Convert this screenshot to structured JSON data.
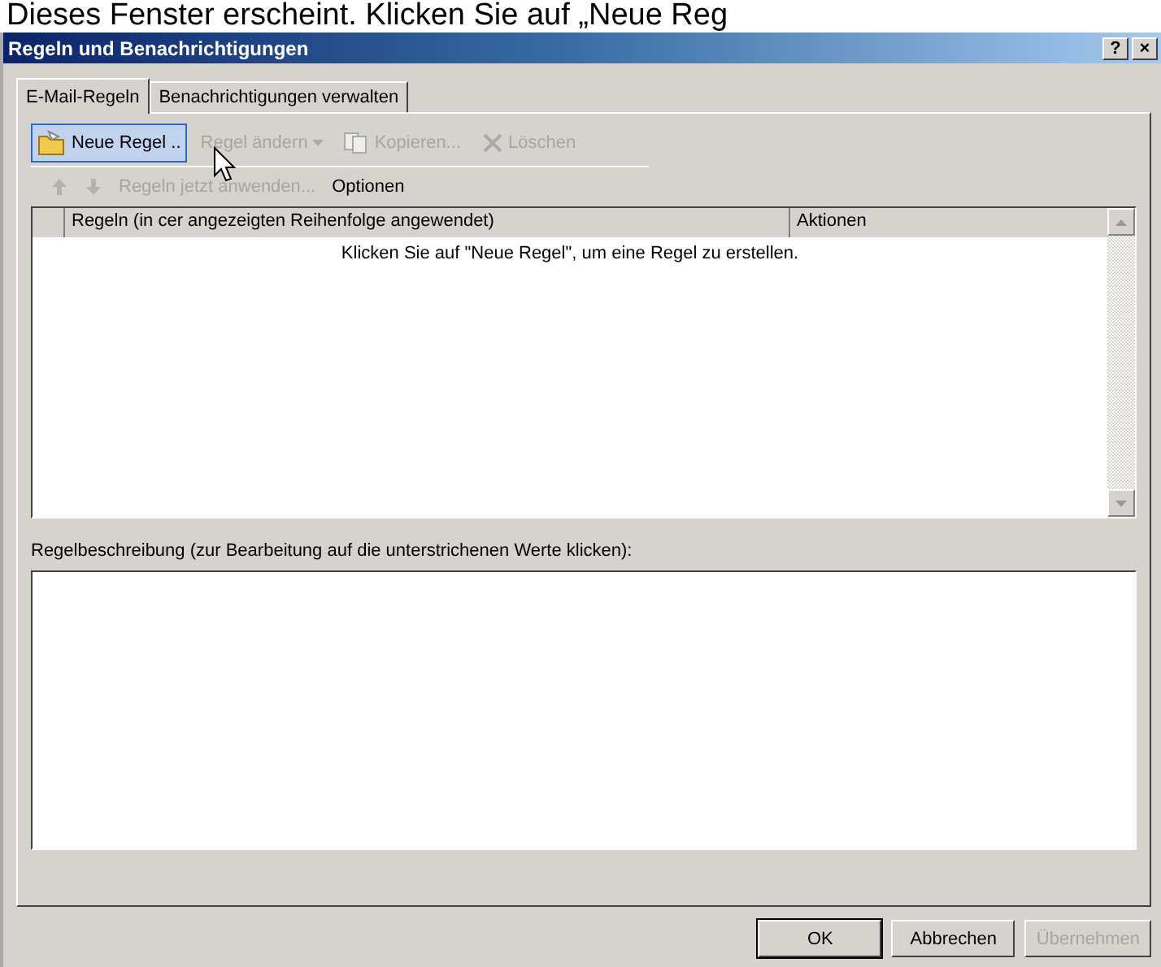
{
  "caption": "Dieses Fenster erscheint. Klicken Sie auf „Neue Reg",
  "window": {
    "title": "Regeln und Benachrichtigungen",
    "help": "?",
    "close": "×"
  },
  "tabs": [
    {
      "label": "E-Mail-Regeln",
      "selected": true
    },
    {
      "label": "Benachrichtigungen verwalten",
      "selected": false
    }
  ],
  "toolbar": [
    {
      "kind": "folder",
      "label": "Neue Regel ..",
      "disabled": false,
      "highlighted": true
    },
    {
      "kind": "dropdown",
      "label": "Regel ändern",
      "disabled": true,
      "highlighted": false
    },
    {
      "kind": "copy",
      "label": "Kopieren...",
      "disabled": true,
      "highlighted": false
    },
    {
      "kind": "delete",
      "label": "Löschen",
      "disabled": true,
      "highlighted": false
    }
  ],
  "toolbar2": [
    {
      "kind": "up",
      "disabled": true
    },
    {
      "kind": "down",
      "disabled": true
    },
    {
      "kind": "text",
      "label": "Regeln jetzt anwenden...",
      "disabled": true
    },
    {
      "kind": "text",
      "label": "Optionen",
      "disabled": false
    }
  ],
  "table": {
    "columns": [
      "Regeln (in cer angezeigten Reihenfolge angewendet)",
      "Aktionen"
    ],
    "empty_message": "Klicken Sie auf \"Neue Regel\", um eine Regel zu erstellen."
  },
  "description": {
    "label": "Regelbeschreibung (zur Bearbeitung auf die unterstrichenen Werte klicken):"
  },
  "buttons": [
    {
      "label": "OK",
      "disabled": false,
      "default": true
    },
    {
      "label": "Abbrechen",
      "disabled": false,
      "default": false
    },
    {
      "label": "Übernehmen",
      "disabled": true,
      "default": false
    }
  ]
}
